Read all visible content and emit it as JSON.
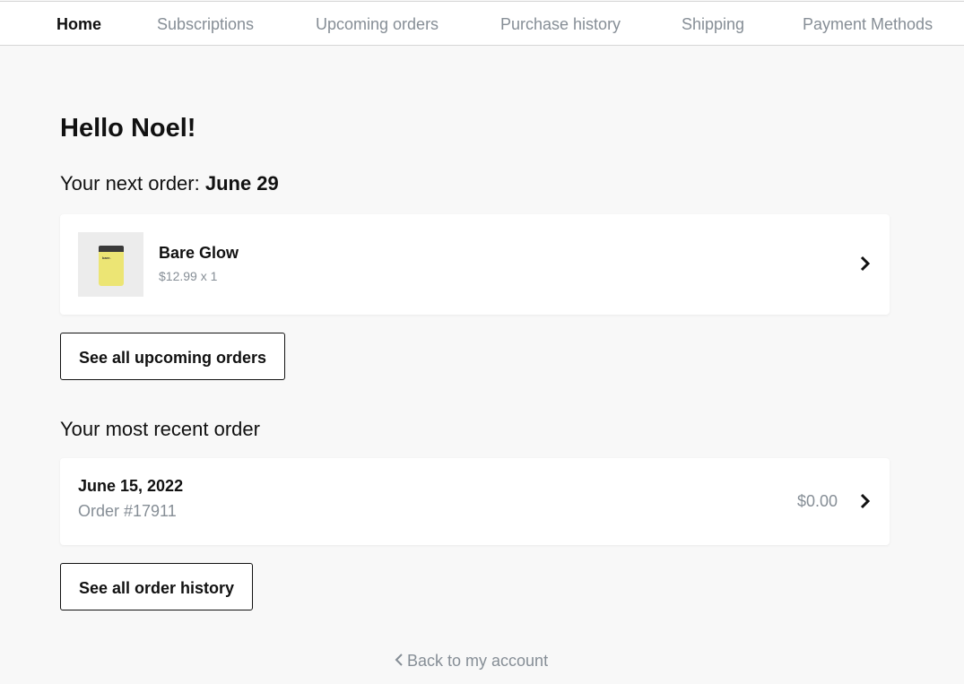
{
  "nav": {
    "items": [
      {
        "label": "Home",
        "active": true
      },
      {
        "label": "Subscriptions",
        "active": false
      },
      {
        "label": "Upcoming orders",
        "active": false
      },
      {
        "label": "Purchase history",
        "active": false
      },
      {
        "label": "Shipping",
        "active": false
      },
      {
        "label": "Payment Methods",
        "active": false
      }
    ]
  },
  "greeting": "Hello Noel!",
  "next_order": {
    "label": "Your next order: ",
    "date": "June 29",
    "product": {
      "name": "Bare Glow",
      "price_qty": "$12.99 x 1",
      "thumb_brand": "bare.",
      "thumb_icon": "product-jar-icon"
    },
    "see_all_label": "See all upcoming orders"
  },
  "recent_order": {
    "heading": "Your most recent order",
    "date": "June 15, 2022",
    "order_number": "Order #17911",
    "total": "$0.00",
    "see_all_label": "See all order history"
  },
  "back_link": "Back to my account",
  "colors": {
    "background": "#f8f8f8",
    "muted_text": "#868e96",
    "text": "#111111",
    "card": "#ffffff"
  }
}
